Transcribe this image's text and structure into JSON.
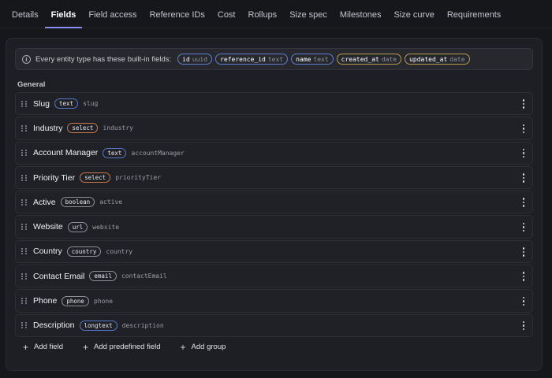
{
  "tabs": [
    "Details",
    "Fields",
    "Field access",
    "Reference IDs",
    "Cost",
    "Rollups",
    "Size spec",
    "Milestones",
    "Size curve",
    "Requirements"
  ],
  "active_tab": "Fields",
  "banner": {
    "text": "Every entity type has these built-in fields:",
    "builtins": [
      {
        "name": "id",
        "type": "uuid",
        "color": "blue"
      },
      {
        "name": "reference_id",
        "type": "text",
        "color": "blue"
      },
      {
        "name": "name",
        "type": "text",
        "color": "blue"
      },
      {
        "name": "created_at",
        "type": "date",
        "color": "gold"
      },
      {
        "name": "updated_at",
        "type": "date",
        "color": "gold"
      }
    ]
  },
  "section_title": "General",
  "fields": [
    {
      "label": "Slug",
      "type": "text",
      "type_color": "blue",
      "key": "slug"
    },
    {
      "label": "Industry",
      "type": "select",
      "type_color": "orange",
      "key": "industry"
    },
    {
      "label": "Account Manager",
      "type": "text",
      "type_color": "blue",
      "key": "accountManager"
    },
    {
      "label": "Priority Tier",
      "type": "select",
      "type_color": "orange",
      "key": "priorityTier"
    },
    {
      "label": "Active",
      "type": "boolean",
      "type_color": "gray",
      "key": "active"
    },
    {
      "label": "Website",
      "type": "url",
      "type_color": "gray",
      "key": "website"
    },
    {
      "label": "Country",
      "type": "country",
      "type_color": "gray",
      "key": "country"
    },
    {
      "label": "Contact Email",
      "type": "email",
      "type_color": "gray",
      "key": "contactEmail"
    },
    {
      "label": "Phone",
      "type": "phone",
      "type_color": "gray",
      "key": "phone"
    },
    {
      "label": "Description",
      "type": "longtext",
      "type_color": "blue",
      "key": "description"
    }
  ],
  "actions": {
    "add_field": "Add field",
    "add_predefined_field": "Add predefined field",
    "add_group": "Add group"
  },
  "colors": {
    "accent": "#8a8cf6",
    "blue_chip": "#5677c8",
    "orange_chip": "#c9784a",
    "gold_chip": "#b89a4e"
  }
}
